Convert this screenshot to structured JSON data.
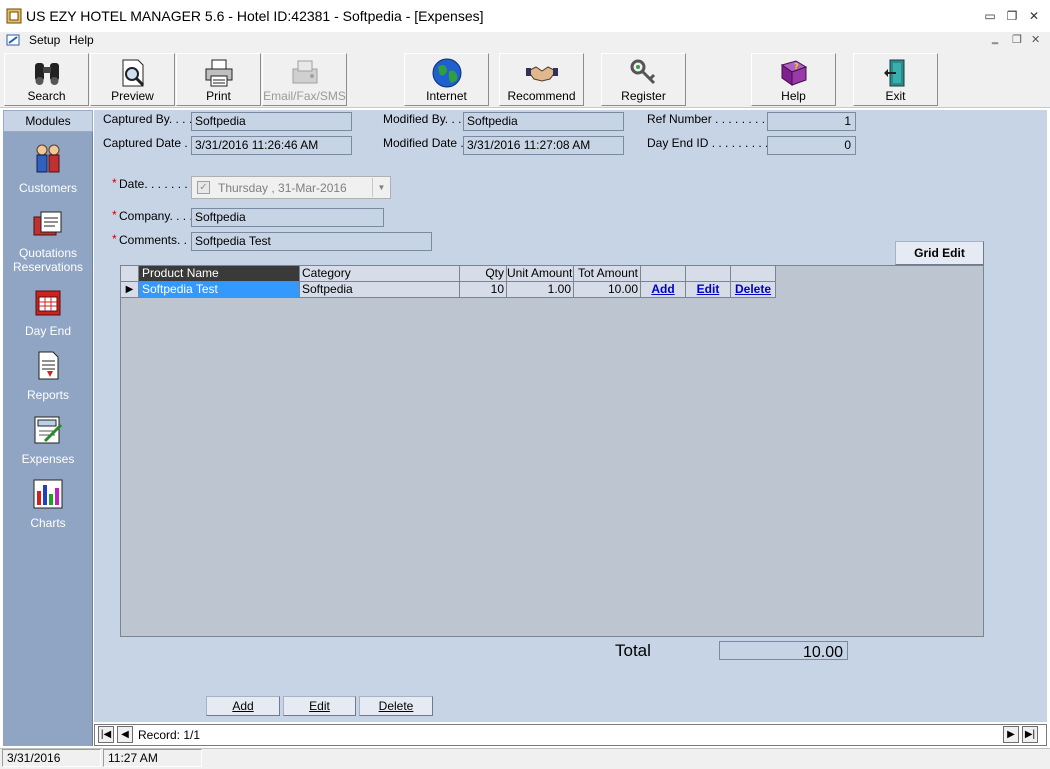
{
  "window": {
    "title": "US EZY HOTEL MANAGER 5.6 - Hotel ID:42381 - Softpedia - [Expenses]",
    "minimize": "▭",
    "restore": "❐",
    "close": "✕"
  },
  "menu": {
    "items": [
      "Setup",
      "Help"
    ],
    "mdi_minimize": "‗",
    "mdi_restore": "❐",
    "mdi_close": "✕"
  },
  "toolbar": {
    "buttons": [
      {
        "label": "Search",
        "icon": "binoculars-icon"
      },
      {
        "label": "Preview",
        "icon": "preview-icon"
      },
      {
        "label": "Print",
        "icon": "printer-icon"
      },
      {
        "label": "Email/Fax/SMS",
        "icon": "fax-icon"
      },
      {
        "label": "Internet",
        "icon": "globe-icon"
      },
      {
        "label": "Recommend",
        "icon": "handshake-icon"
      },
      {
        "label": "Register",
        "icon": "keys-icon"
      },
      {
        "label": "Help",
        "icon": "help-book-icon"
      },
      {
        "label": "Exit",
        "icon": "exit-door-icon"
      }
    ]
  },
  "sidebar": {
    "header": "Modules",
    "items": [
      {
        "label": "Customers",
        "icon": "customers-icon"
      },
      {
        "label": "Quotations",
        "label2": "Reservations",
        "icon": "quotations-icon"
      },
      {
        "label": "Day End",
        "icon": "day-end-icon"
      },
      {
        "label": "Reports",
        "icon": "reports-icon"
      },
      {
        "label": "Expenses",
        "icon": "expenses-icon"
      },
      {
        "label": "Charts",
        "icon": "charts-icon"
      }
    ]
  },
  "form": {
    "captured_by_label": "Captured By. . . . .",
    "captured_by": "Softpedia",
    "captured_date_label": "Captured Date  . .",
    "captured_date": "3/31/2016 11:26:46 AM",
    "modified_by_label": "Modified By. . . . .",
    "modified_by": "Softpedia",
    "modified_date_label": "Modified Date  . .",
    "modified_date": "3/31/2016 11:27:08 AM",
    "ref_number_label": "Ref Number . . . . . . . . . .",
    "ref_number": "1",
    "day_end_label": "Day End ID . . . . . . . . . .",
    "day_end": "0",
    "required_mark": "*",
    "date_label": "Date. . . . . . . .",
    "date_value": "Thursday  , 31-Mar-2016",
    "company_label": "Company. . . . .",
    "company": "Softpedia",
    "comments_label": "Comments. . . .",
    "comments": "Softpedia Test",
    "grid_edit": "Grid Edit"
  },
  "grid": {
    "columns": [
      "Product Name",
      "Category",
      "Qty",
      "Unit Amount",
      "Tot Amount",
      "",
      "",
      ""
    ],
    "rows": [
      {
        "product": "Softpedia Test",
        "category": "Softpedia",
        "qty": "10",
        "unit": "1.00",
        "total": "10.00",
        "add": "Add",
        "edit": "Edit",
        "delete": "Delete"
      }
    ]
  },
  "total": {
    "label": "Total",
    "value": "10.00"
  },
  "actions": {
    "add": "Add",
    "edit": "Edit",
    "delete": "Delete"
  },
  "navigator": {
    "record": "Record: 1/1"
  },
  "status": {
    "date": "3/31/2016",
    "time": "11:27 AM"
  },
  "colors": {
    "sidebar": "#8fa5c3",
    "panel": "#c7d4e6",
    "selection": "#3399ff",
    "link": "#0000cc"
  }
}
